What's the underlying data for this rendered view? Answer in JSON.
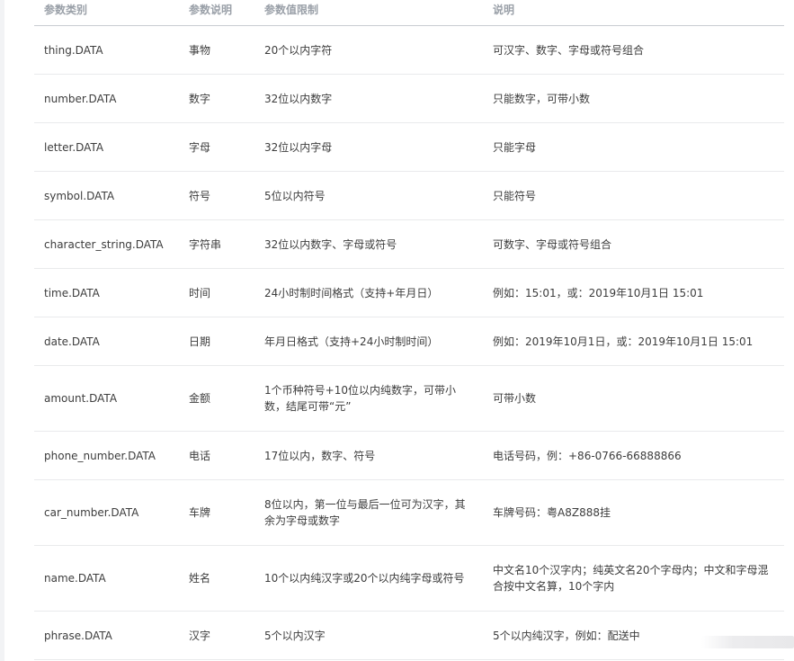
{
  "table": {
    "headers": [
      "参数类别",
      "参数说明",
      "参数值限制",
      "说明"
    ],
    "rows": [
      {
        "category": "thing.DATA",
        "desc": "事物",
        "limit": "20个以内字符",
        "note": "可汉字、数字、字母或符号组合"
      },
      {
        "category": "number.DATA",
        "desc": "数字",
        "limit": "32位以内数字",
        "note": "只能数字，可带小数"
      },
      {
        "category": "letter.DATA",
        "desc": "字母",
        "limit": "32位以内字母",
        "note": "只能字母"
      },
      {
        "category": "symbol.DATA",
        "desc": "符号",
        "limit": "5位以内符号",
        "note": "只能符号"
      },
      {
        "category": "character_string.DATA",
        "desc": "字符串",
        "limit": "32位以内数字、字母或符号",
        "note": "可数字、字母或符号组合"
      },
      {
        "category": "time.DATA",
        "desc": "时间",
        "limit": "24小时制时间格式（支持+年月日）",
        "note": "例如：15:01，或：2019年10月1日 15:01"
      },
      {
        "category": "date.DATA",
        "desc": "日期",
        "limit": "年月日格式（支持+24小时制时间）",
        "note": "例如：2019年10月1日，或：2019年10月1日 15:01"
      },
      {
        "category": "amount.DATA",
        "desc": "金额",
        "limit": "1个币种符号+10位以内纯数字，可带小数，结尾可带“元”",
        "note": "可带小数"
      },
      {
        "category": "phone_number.DATA",
        "desc": "电话",
        "limit": "17位以内，数字、符号",
        "note": "电话号码，例：+86-0766-66888866"
      },
      {
        "category": "car_number.DATA",
        "desc": "车牌",
        "limit": "8位以内，第一位与最后一位可为汉字，其余为字母或数字",
        "note": "车牌号码：粤A8Z888挂"
      },
      {
        "category": "name.DATA",
        "desc": "姓名",
        "limit": "10个以内纯汉字或20个以内纯字母或符号",
        "note": "中文名10个汉字内；纯英文名20个字母内；中文和字母混合按中文名算，10个字内"
      },
      {
        "category": "phrase.DATA",
        "desc": "汉字",
        "limit": "5个以内汉字",
        "note": "5个以内纯汉字，例如：配送中"
      }
    ]
  }
}
